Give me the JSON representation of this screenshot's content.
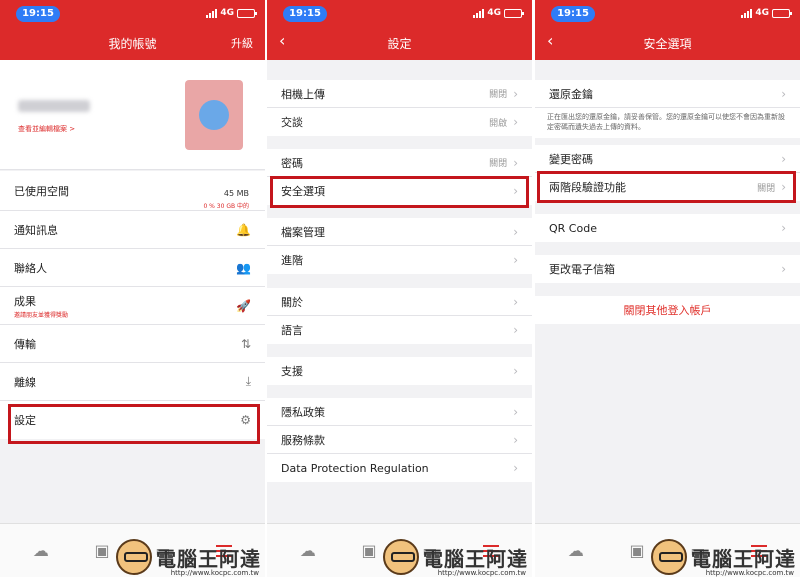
{
  "status": {
    "time": "19:15",
    "network": "4G"
  },
  "screen1": {
    "title": "我的帳號",
    "upgrade": "升級",
    "profile_link": "查看並編輯檔案 >",
    "usage_label": "已使用空間",
    "usage_value": "45 MB",
    "usage_sub": "0 % 30 GB 中的",
    "items": [
      {
        "label": "通知訊息",
        "icon": "bell-icon",
        "glyph": "🔔"
      },
      {
        "label": "聯絡人",
        "icon": "contacts-icon",
        "glyph": "👥"
      },
      {
        "label": "成果",
        "sub": "邀請朋友並獲得獎勵",
        "icon": "rocket-icon",
        "glyph": "🚀"
      },
      {
        "label": "傳輸",
        "icon": "transfer-icon",
        "glyph": "⇅"
      },
      {
        "label": "離線",
        "icon": "offline-icon",
        "glyph": "⤓"
      },
      {
        "label": "設定",
        "icon": "gear-icon",
        "glyph": "⚙"
      }
    ]
  },
  "screen2": {
    "title": "設定",
    "groups": [
      [
        {
          "label": "相機上傳",
          "value": "關閉"
        },
        {
          "label": "交談",
          "value": "開啟"
        }
      ],
      [
        {
          "label": "密碼",
          "value": "關閉"
        },
        {
          "label": "安全選項",
          "value": ""
        }
      ],
      [
        {
          "label": "檔案管理",
          "value": ""
        },
        {
          "label": "進階",
          "value": ""
        }
      ],
      [
        {
          "label": "關於",
          "value": ""
        },
        {
          "label": "語言",
          "value": ""
        }
      ],
      [
        {
          "label": "支援",
          "value": ""
        }
      ],
      [
        {
          "label": "隱私政策",
          "value": ""
        },
        {
          "label": "服務條款",
          "value": ""
        },
        {
          "label": "Data Protection Regulation",
          "value": ""
        }
      ]
    ]
  },
  "screen3": {
    "title": "安全選項",
    "recovery_key": "還原金鑰",
    "recovery_note": "正在匯出您的還原金鑰，請妥善保管。您的還原金鑰可以使您不會因為重新設定密碼而遺失過去上傳的資料。",
    "change_password": "變更密碼",
    "two_factor": "兩階段驗證功能",
    "two_factor_value": "關閉",
    "qr_code": "QR Code",
    "change_email": "更改電子信箱",
    "logout_others": "關閉其他登入帳戶"
  },
  "watermark": {
    "text": "電腦王阿達",
    "url": "http://www.kocpc.com.tw"
  },
  "colors": {
    "brand": "#dc2a2a",
    "highlight": "#c4161c",
    "status_pill": "#2f7cf6"
  }
}
